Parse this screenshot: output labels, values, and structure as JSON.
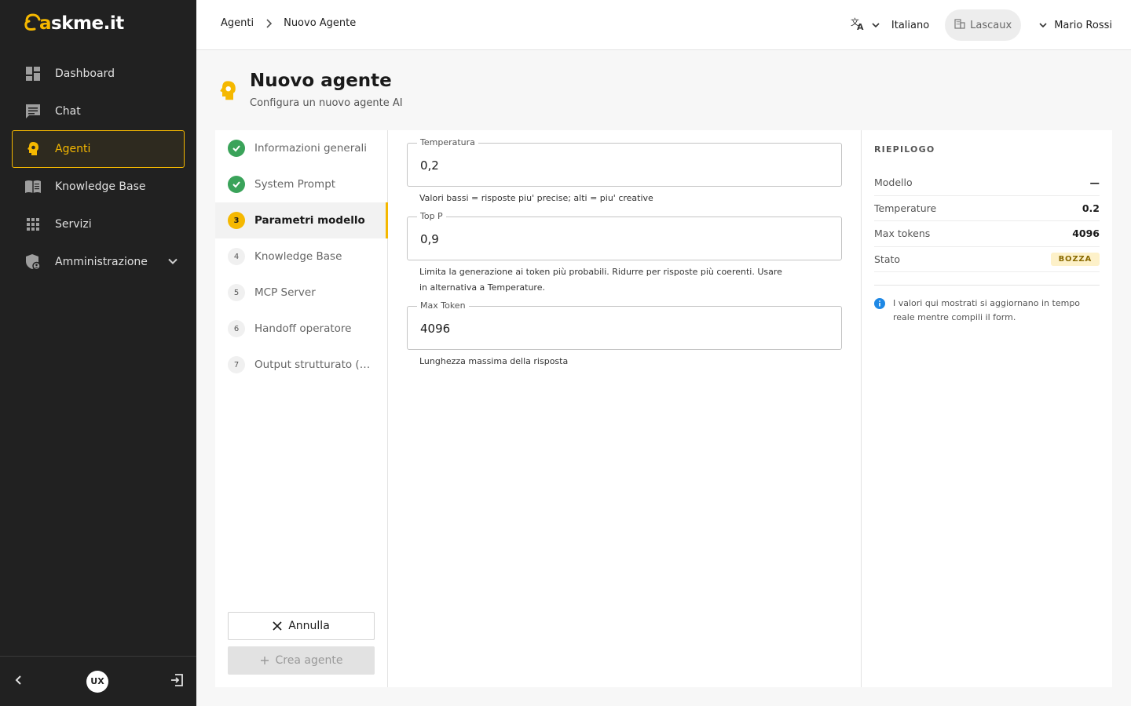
{
  "app": {
    "logo_prefix": "a",
    "logo_main": "skme.it"
  },
  "sidebar": {
    "items": [
      {
        "label": "Dashboard",
        "icon": "dashboard-icon"
      },
      {
        "label": "Chat",
        "icon": "chat-icon"
      },
      {
        "label": "Agenti",
        "icon": "agent-icon",
        "active": true
      },
      {
        "label": "Knowledge Base",
        "icon": "book-icon"
      },
      {
        "label": "Servizi",
        "icon": "grid-icon"
      },
      {
        "label": "Amministrazione",
        "icon": "admin-shield-icon"
      }
    ],
    "bottom_badge": "UX"
  },
  "header": {
    "breadcrumb": [
      "Agenti",
      "Nuovo Agente"
    ],
    "language": "Italiano",
    "organization": "Lascaux",
    "user": "Mario Rossi"
  },
  "page": {
    "title": "Nuovo agente",
    "subtitle": "Configura un nuovo agente AI"
  },
  "steps": [
    {
      "num": "1",
      "label": "Informazioni generali",
      "state": "done"
    },
    {
      "num": "2",
      "label": "System Prompt",
      "state": "done"
    },
    {
      "num": "3",
      "label": "Parametri modello",
      "state": "current"
    },
    {
      "num": "4",
      "label": "Knowledge Base",
      "state": "todo"
    },
    {
      "num": "5",
      "label": "MCP Server",
      "state": "todo"
    },
    {
      "num": "6",
      "label": "Handoff operatore",
      "state": "todo"
    },
    {
      "num": "7",
      "label": "Output strutturato (JSON)",
      "state": "todo"
    }
  ],
  "actions": {
    "cancel": "Annulla",
    "create": "Crea agente"
  },
  "form": {
    "temperature": {
      "label": "Temperatura",
      "value": "0,2",
      "helper": "Valori bassi = risposte piu' precise; alti = piu' creative"
    },
    "top_p": {
      "label": "Top P",
      "value": "0,9",
      "helper": "Limita la generazione ai token più probabili. Ridurre per risposte più coerenti. Usare in alternativa a Temperature."
    },
    "max_token": {
      "label": "Max Token",
      "value": "4096",
      "helper": "Lunghezza massima della risposta"
    }
  },
  "summary": {
    "title": "RIEPILOGO",
    "rows": [
      {
        "label": "Modello",
        "value": "—"
      },
      {
        "label": "Temperature",
        "value": "0.2"
      },
      {
        "label": "Max tokens",
        "value": "4096"
      }
    ],
    "status_label": "Stato",
    "status_value": "BOZZA",
    "info": "I valori qui mostrati si aggiornano in tempo reale mentre compili il form."
  },
  "colors": {
    "accent": "#f5b800",
    "sidebar_bg": "#212121",
    "done_green": "#3aa35a",
    "info_blue": "#1e88e5"
  }
}
